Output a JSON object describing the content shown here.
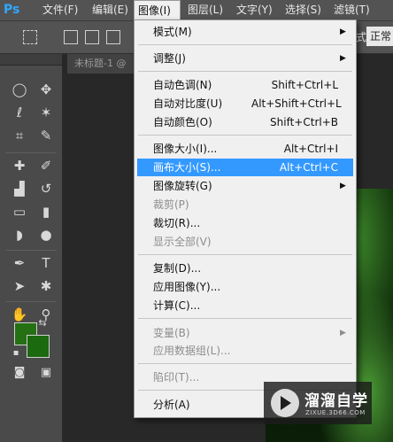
{
  "app": {
    "logo": "Ps"
  },
  "menubar": {
    "items": [
      "文件(F)",
      "编辑(E)",
      "图像(I)",
      "图层(L)",
      "文字(Y)",
      "选择(S)",
      "滤镜(T)"
    ]
  },
  "options_bar": {
    "label": "式:",
    "field_value": "正常"
  },
  "document": {
    "tab_title": "未标题-1 @"
  },
  "image_menu": {
    "items": [
      {
        "label": "模式(M)",
        "submenu": true
      },
      {
        "label": "调整(J)",
        "submenu": true
      },
      {
        "label": "自动色调(N)",
        "shortcut": "Shift+Ctrl+L"
      },
      {
        "label": "自动对比度(U)",
        "shortcut": "Alt+Shift+Ctrl+L"
      },
      {
        "label": "自动颜色(O)",
        "shortcut": "Shift+Ctrl+B"
      },
      {
        "label": "图像大小(I)...",
        "shortcut": "Alt+Ctrl+I"
      },
      {
        "label": "画布大小(S)...",
        "shortcut": "Alt+Ctrl+C",
        "highlighted": true
      },
      {
        "label": "图像旋转(G)",
        "submenu": true
      },
      {
        "label": "裁剪(P)",
        "disabled": true
      },
      {
        "label": "裁切(R)..."
      },
      {
        "label": "显示全部(V)",
        "disabled": true
      },
      {
        "label": "复制(D)..."
      },
      {
        "label": "应用图像(Y)..."
      },
      {
        "label": "计算(C)..."
      },
      {
        "label": "变量(B)",
        "submenu": true,
        "disabled": true
      },
      {
        "label": "应用数据组(L)...",
        "disabled": true
      },
      {
        "label": "陷印(T)...",
        "disabled": true
      },
      {
        "label": "分析(A)",
        "submenu": true
      }
    ]
  },
  "swatches": {
    "foreground": "#247013",
    "background": "#1b6a10"
  },
  "accent_color": "#3399ff",
  "watermark": {
    "name": "溜溜自学",
    "url": "ZIXUE.3D66.COM"
  }
}
